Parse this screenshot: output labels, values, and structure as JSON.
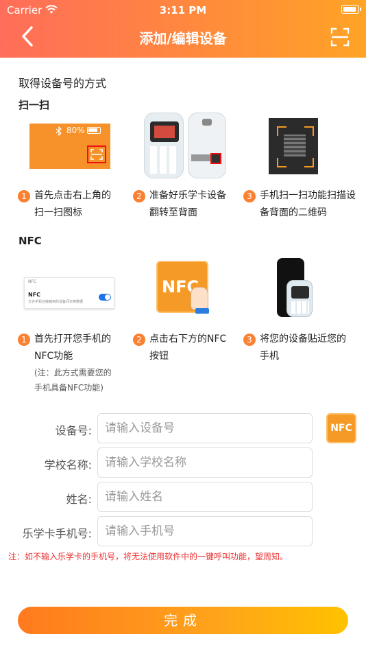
{
  "status_bar": {
    "carrier": "Carrier",
    "time": "3:11 PM",
    "battery_level": 0.9
  },
  "header": {
    "title": "添加/编辑设备"
  },
  "methods_title": "取得设备号的方式",
  "scan_section": {
    "title": "扫一扫",
    "phone_battery": "80%",
    "steps": [
      {
        "num": "1",
        "text": "首先点击右上角的扫一扫图标"
      },
      {
        "num": "2",
        "text": "准备好乐学卡设备翻转至背面"
      },
      {
        "num": "3",
        "text": "手机扫一扫功能扫描设备背面的二维码"
      }
    ]
  },
  "nfc_section": {
    "title": "NFC",
    "setting_header": "NFC",
    "setting_title": "NFC",
    "setting_desc": "允许手机在接触到的设备间交换数据",
    "nfc_icon_text": "NFC",
    "steps": [
      {
        "num": "1",
        "text": "首先打开您手机的NFC功能",
        "note": "(注：此方式需要您的手机具备NFC功能)"
      },
      {
        "num": "2",
        "text": "点击右下方的NFC按钮"
      },
      {
        "num": "3",
        "text": "将您的设备贴近您的手机"
      }
    ]
  },
  "form": {
    "device_label": "设备号:",
    "device_placeholder": "请输入设备号",
    "nfc_button": "NFC",
    "school_label": "学校名称:",
    "school_placeholder": "请输入学校名称",
    "name_label": "姓名:",
    "name_placeholder": "请输入姓名",
    "phone_label": "乐学卡手机号:",
    "phone_placeholder": "请输入手机号"
  },
  "warning": "注：如不输入乐学卡的手机号，将无法使用软件中的一键呼叫功能，望周知。",
  "done_button": "完成"
}
